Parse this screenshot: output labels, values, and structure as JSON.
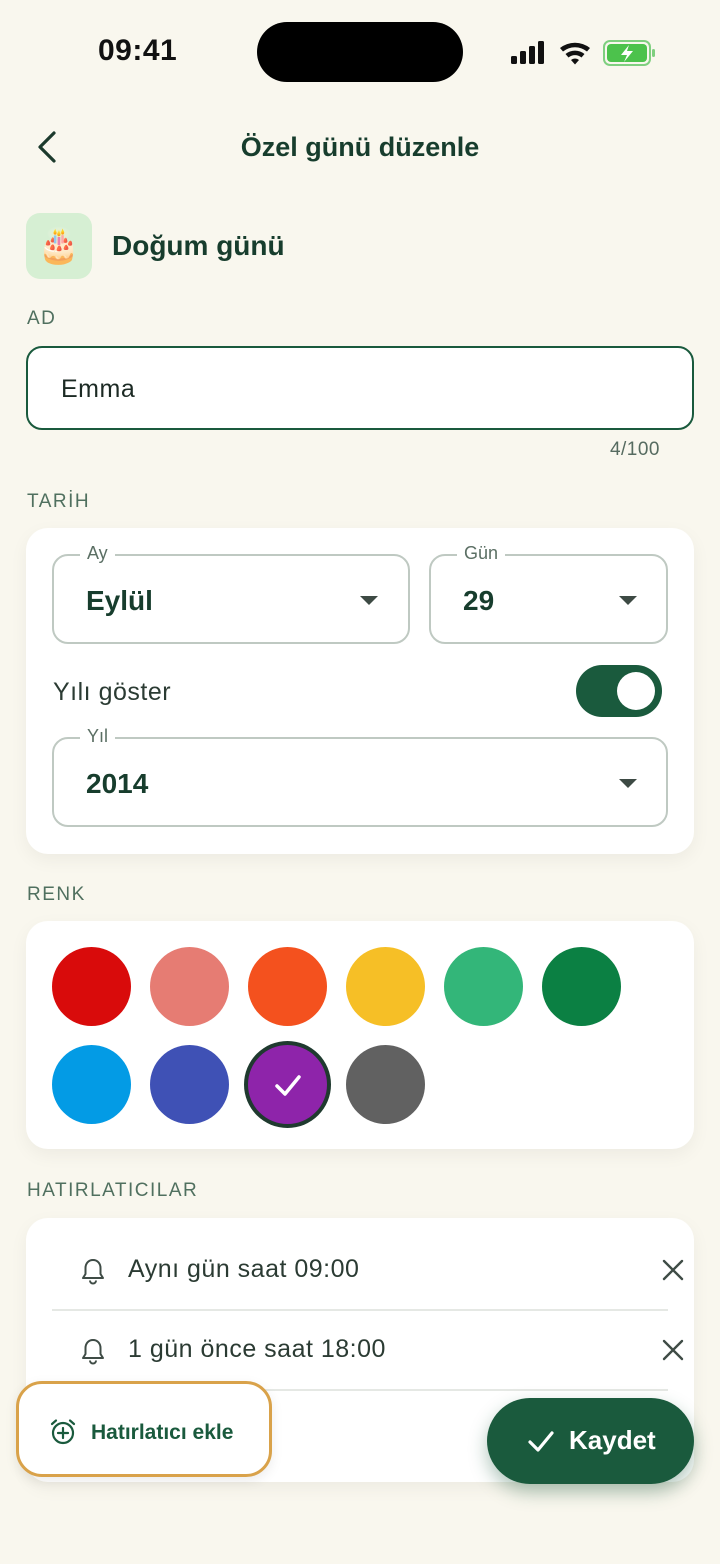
{
  "status_bar": {
    "time": "09:41"
  },
  "header": {
    "title": "Özel günü düzenle"
  },
  "occasion": {
    "label": "Doğum günü",
    "icon": "birthday-cake-icon",
    "emoji": "🎂"
  },
  "name": {
    "section_label": "AD",
    "value": "Emma",
    "char_count": "4/100"
  },
  "date": {
    "section_label": "TARİH",
    "month": {
      "legend": "Ay",
      "value": "Eylül"
    },
    "day": {
      "legend": "Gün",
      "value": "29"
    },
    "show_year_label": "Yılı göster",
    "show_year": true,
    "year": {
      "legend": "Yıl",
      "value": "2014"
    }
  },
  "colors": {
    "section_label": "RENK",
    "swatches": [
      "#d90b0b",
      "#e67c73",
      "#f4511e",
      "#f6bf26",
      "#33b679",
      "#0b8043",
      "#039be5",
      "#3f51b5",
      "#8e24aa",
      "#616161"
    ],
    "selected": "#8e24aa"
  },
  "reminders": {
    "section_label": "HATIRLATICILAR",
    "items": [
      {
        "text": "Aynı gün saat 09:00"
      },
      {
        "text": "1 gün önce saat 18:00"
      }
    ],
    "add_label": "Hatırlatıcı ekle"
  },
  "save_label": "Kaydet",
  "theme": {
    "primary": "#1a5a3d",
    "background": "#f9f7ee",
    "highlight": "#d9a24a"
  }
}
